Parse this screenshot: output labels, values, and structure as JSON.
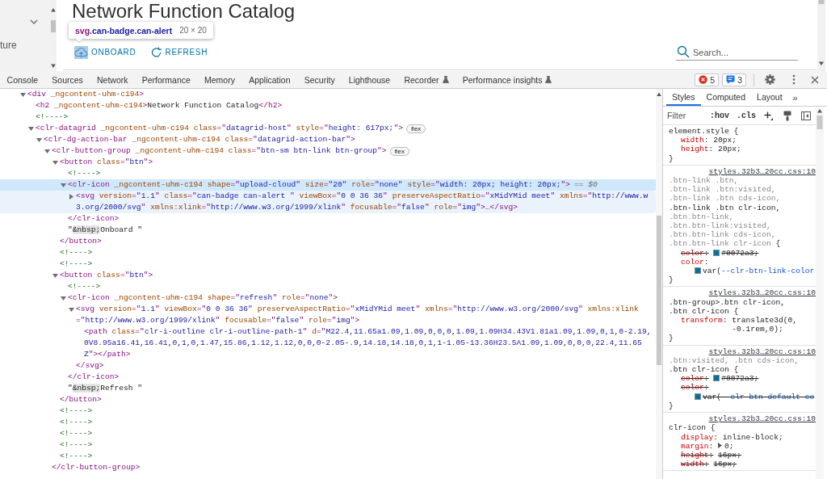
{
  "page": {
    "sidebar": {
      "items": [
        {
          "label": "ture"
        }
      ]
    },
    "title": "Network Function Catalog",
    "inspect_tooltip": {
      "selector": "svg.can-badge.can-alert",
      "size": "20 × 20"
    },
    "buttons": [
      {
        "kind": "upload",
        "label": "ONBOARD",
        "highlighted": true
      },
      {
        "kind": "refresh",
        "label": "REFRESH",
        "highlighted": false
      }
    ],
    "search": {
      "placeholder": "Search..."
    }
  },
  "devtools": {
    "tabs": [
      {
        "label": "Console",
        "selected": false,
        "experimental": false
      },
      {
        "label": "Sources",
        "selected": false,
        "experimental": false
      },
      {
        "label": "Network",
        "selected": false,
        "experimental": false
      },
      {
        "label": "Performance",
        "selected": false,
        "experimental": false
      },
      {
        "label": "Memory",
        "selected": false,
        "experimental": false
      },
      {
        "label": "Application",
        "selected": false,
        "experimental": false
      },
      {
        "label": "Security",
        "selected": false,
        "experimental": false
      },
      {
        "label": "Lighthouse",
        "selected": false,
        "experimental": false
      },
      {
        "label": "Recorder",
        "selected": false,
        "experimental": true
      },
      {
        "label": "Performance insights",
        "selected": false,
        "experimental": true
      }
    ],
    "counters": [
      {
        "kind": "error",
        "count": "5"
      },
      {
        "kind": "info",
        "count": "3"
      }
    ]
  },
  "dom_tree": [
    {
      "kind": "element",
      "markup": "<div _ngcontent-uhm-c194>",
      "expanded": true,
      "selected": false,
      "hovered": false,
      "children": [
        {
          "kind": "leaf",
          "markup": "<h2 _ngcontent-uhm-c194>Network Function Catalog</h2>",
          "selected": false,
          "hovered": false
        },
        {
          "kind": "comment",
          "markup": "<!---->",
          "selected": false,
          "hovered": false
        },
        {
          "kind": "element",
          "markup": "<clr-datagrid _ngcontent-uhm-c194 class=\"datagrid-host\" style=\"height: 617px;\">",
          "badge": "flex",
          "expanded": true,
          "selected": false,
          "hovered": false,
          "children": [
            {
              "kind": "element",
              "markup": "<clr-dg-action-bar _ngcontent-uhm-c194 class=\"datagrid-action-bar\">",
              "expanded": true,
              "selected": false,
              "hovered": false,
              "children": [
                {
                  "kind": "element",
                  "markup": "<clr-button-group _ngcontent-uhm-c194 class=\"btn-sm btn-link btn-group\">",
                  "badge": "flex",
                  "expanded": true,
                  "selected": false,
                  "hovered": false,
                  "close": "</clr-button-group>",
                  "children": [
                    {
                      "kind": "element",
                      "markup": "<button class=\"btn\">",
                      "expanded": true,
                      "selected": false,
                      "hovered": false,
                      "close": "</button>",
                      "children": [
                        {
                          "kind": "comment",
                          "markup": "<!---->",
                          "selected": false,
                          "hovered": false
                        },
                        {
                          "kind": "element",
                          "markup": "<clr-icon _ngcontent-uhm-c194 shape=\"upload-cloud\" size=\"20\" role=\"none\" style=\"width: 20px; height: 20px;\">",
                          "reference": "== $0",
                          "expanded": true,
                          "selected": true,
                          "hovered": false,
                          "close": "</clr-icon>",
                          "children": [
                            {
                              "kind": "element",
                              "markup": "<svg version=\"1.1\" class=\"can-badge can-alert \" viewBox=\"0 0 36 36\" preserveAspectRatio=\"xMidYMid meet\" xmlns=\"http://www.w3.org/2000/svg\" xmlns:xlink=\"http://www.w3.org/1999/xlink\" focusable=\"false\" role=\"img\">…</svg>",
                              "expanded": false,
                              "selected": false,
                              "hovered": true
                            }
                          ]
                        },
                        {
                          "kind": "text",
                          "markup": "\"&nbsp;Onboard \"",
                          "selected": false,
                          "hovered": false
                        }
                      ]
                    },
                    {
                      "kind": "comment",
                      "markup": "<!---->",
                      "selected": false,
                      "hovered": false
                    },
                    {
                      "kind": "comment",
                      "markup": "<!---->",
                      "selected": false,
                      "hovered": false
                    },
                    {
                      "kind": "element",
                      "markup": "<button class=\"btn\">",
                      "expanded": true,
                      "selected": false,
                      "hovered": false,
                      "close": "</button>",
                      "children": [
                        {
                          "kind": "comment",
                          "markup": "<!---->",
                          "selected": false,
                          "hovered": false
                        },
                        {
                          "kind": "element",
                          "markup": "<clr-icon _ngcontent-uhm-c194 shape=\"refresh\" role=\"none\">",
                          "expanded": true,
                          "selected": false,
                          "hovered": false,
                          "close": "</clr-icon>",
                          "children": [
                            {
                              "kind": "element",
                              "markup": "<svg version=\"1.1\" viewBox=\"0 0 36 36\" preserveAspectRatio=\"xMidYMid meet\" xmlns=\"http://www.w3.org/2000/svg\" xmlns:xlink=\"http://www.w3.org/1999/xlink\" focusable=\"false\" role=\"img\">",
                              "expanded": true,
                              "selected": false,
                              "hovered": false,
                              "close": "</svg>",
                              "children": [
                                {
                                  "kind": "leaf",
                                  "markup": "<path class=\"clr-i-outline clr-i-outline-path-1\" d=\"M22.4,11.65a1.09,1.09,0,0,0,1.09,1.09H34.43V1.81a1.09,1.09,0,1,0-2.19,0V8.95a16.41,16.41,0,1,0,1.47,15.86,1.12,1.12,0,0,0-2.05-.9,14.18,14.18,0,1,1-1.05-13.36H23.5A1.09,1.09,0,0,0,22.4,11.65Z\"></path>",
                                  "selected": false,
                                  "hovered": false
                                }
                              ]
                            }
                          ]
                        },
                        {
                          "kind": "text",
                          "markup": "\"&nbsp;Refresh \"",
                          "selected": false,
                          "hovered": false
                        }
                      ]
                    },
                    {
                      "kind": "comment",
                      "markup": "<!---->",
                      "selected": false,
                      "hovered": false
                    },
                    {
                      "kind": "comment",
                      "markup": "<!---->",
                      "selected": false,
                      "hovered": false
                    },
                    {
                      "kind": "comment",
                      "markup": "<!---->",
                      "selected": false,
                      "hovered": false
                    },
                    {
                      "kind": "comment",
                      "markup": "<!---->",
                      "selected": false,
                      "hovered": false
                    },
                    {
                      "kind": "comment",
                      "markup": "<!---->",
                      "selected": false,
                      "hovered": false
                    }
                  ]
                }
              ]
            }
          ]
        }
      ]
    }
  ],
  "styles": {
    "tabs": [
      {
        "label": "Styles",
        "selected": true
      },
      {
        "label": "Computed",
        "selected": false
      },
      {
        "label": "Layout",
        "selected": false
      }
    ],
    "more_tabs": "»",
    "filter": {
      "placeholder": "Filter"
    },
    "toggles": [
      ":hov",
      ".cls"
    ],
    "rules": [
      {
        "selector": [
          {
            "text": "element.style",
            "matched": true
          }
        ],
        "open": "{",
        "close": "}",
        "declarations": [
          {
            "property": "width:",
            "value": "20px;",
            "overridden": false
          },
          {
            "property": "height:",
            "value": "20px;",
            "overridden": false
          }
        ]
      },
      {
        "source": "styles.32b3…20cc.css:10",
        "selector": [
          {
            "text": ".btn-link .btn,",
            "matched": false
          },
          {
            "text": ".btn-link .btn:visited,",
            "matched": false
          },
          {
            "text": ".btn-link .btn cds-icon,",
            "matched": false
          },
          {
            "text": ".btn-link .btn clr-icon,",
            "matched": true
          },
          {
            "text": ".btn.btn-link,",
            "matched": false
          },
          {
            "text": ".btn.btn-link:visited,",
            "matched": false
          },
          {
            "text": ".btn.btn-link cds-icon,",
            "matched": false
          },
          {
            "text": ".btn.btn-link clr-icon",
            "matched": false
          }
        ],
        "open": "{",
        "close": "}",
        "declarations": [
          {
            "property": "color:",
            "value": "#0072a3;",
            "color": "#0072a3",
            "overridden": true
          },
          {
            "property": "color:",
            "value": "var(--clr-btn-link-color",
            "color": "#0072a3",
            "overridden": false
          }
        ]
      },
      {
        "source": "styles.32b3…20cc.css:10",
        "selector": [
          {
            "text": ".btn-group>.btn clr-icon,",
            "matched": true
          },
          {
            "text": ".btn clr-icon",
            "matched": true
          }
        ],
        "open": "{",
        "close": "}",
        "declarations": [
          {
            "property": "transform:",
            "value": "translate3d(0, -0.1rem,0);",
            "overridden": false
          }
        ]
      },
      {
        "source": "styles.32b3…20cc.css:10",
        "selector": [
          {
            "text": ".btn:visited,",
            "matched": false
          },
          {
            "text": ".btn cds-icon,",
            "matched": false
          },
          {
            "text": ".btn clr-icon",
            "matched": true
          }
        ],
        "open": "{",
        "close": "}",
        "declarations": [
          {
            "property": "color:",
            "value": "#0072a3;",
            "color": "#0072a3",
            "overridden": true
          },
          {
            "property": "color:",
            "value": "var(--clr-btn-default-co",
            "color": "#0072a3",
            "overridden": true
          }
        ]
      },
      {
        "source": "styles.32b3…20cc.css:10",
        "selector": [
          {
            "text": "clr-icon",
            "matched": true
          }
        ],
        "open": "{",
        "declarations": [
          {
            "property": "display:",
            "value": "inline-block;",
            "overridden": false
          },
          {
            "property": "margin:",
            "value": "0;",
            "overridden": false,
            "expandable": true
          },
          {
            "property": "height:",
            "value": "16px;",
            "overridden": true
          },
          {
            "property": "width:",
            "value": "16px;",
            "overridden": true
          }
        ]
      }
    ]
  }
}
